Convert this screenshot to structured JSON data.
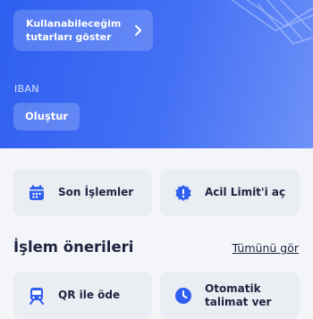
{
  "colors": {
    "primary": "#2f5ff0",
    "text": "#1f2340",
    "card_bg": "#eaedf2"
  },
  "hero": {
    "limit_button_label": "Kullanabileceğim\ntutarları göster",
    "iban_label": "IBAN",
    "create_button_label": "Oluştur"
  },
  "quick_actions": [
    {
      "label": "Son İşlemler",
      "icon": "calendar-icon"
    },
    {
      "label": "Acil Limit'i aç",
      "icon": "alert-badge-icon"
    }
  ],
  "suggestions": {
    "title": "İşlem önerileri",
    "see_all_label": "Tümünü gör",
    "items": [
      {
        "label": "QR ile öde",
        "icon": "train-icon"
      },
      {
        "label": "Otomatik\ntalimat ver",
        "icon": "clock-icon"
      }
    ]
  }
}
